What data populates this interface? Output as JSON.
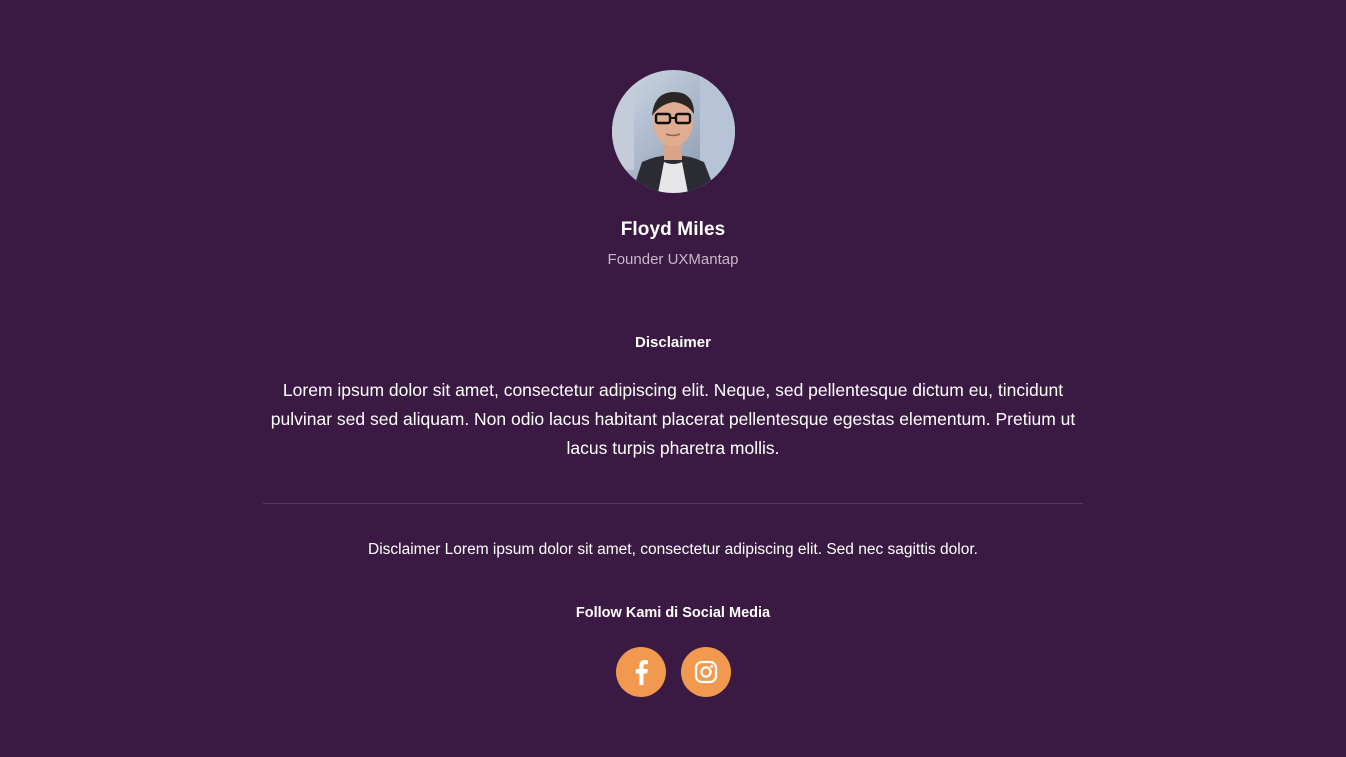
{
  "profile": {
    "name": "Floyd Miles",
    "role": "Founder UXMantap",
    "avatar_icon": "person-photo"
  },
  "disclaimer": {
    "title": "Disclaimer",
    "body": "Lorem ipsum dolor sit amet, consectetur adipiscing elit. Neque, sed pellentesque dictum eu, tincidunt pulvinar sed sed aliquam. Non odio lacus habitant placerat pellentesque egestas elementum. Pretium ut lacus turpis pharetra mollis."
  },
  "footer": {
    "text": "Disclaimer Lorem ipsum dolor sit amet, consectetur adipiscing elit. Sed nec sagittis dolor."
  },
  "social": {
    "title": "Follow Kami di Social Media",
    "links": [
      {
        "icon": "facebook-icon"
      },
      {
        "icon": "instagram-icon"
      }
    ]
  },
  "colors": {
    "background": "#3a1942",
    "accent": "#f19a4f",
    "muted_text": "#c9b8cc"
  }
}
